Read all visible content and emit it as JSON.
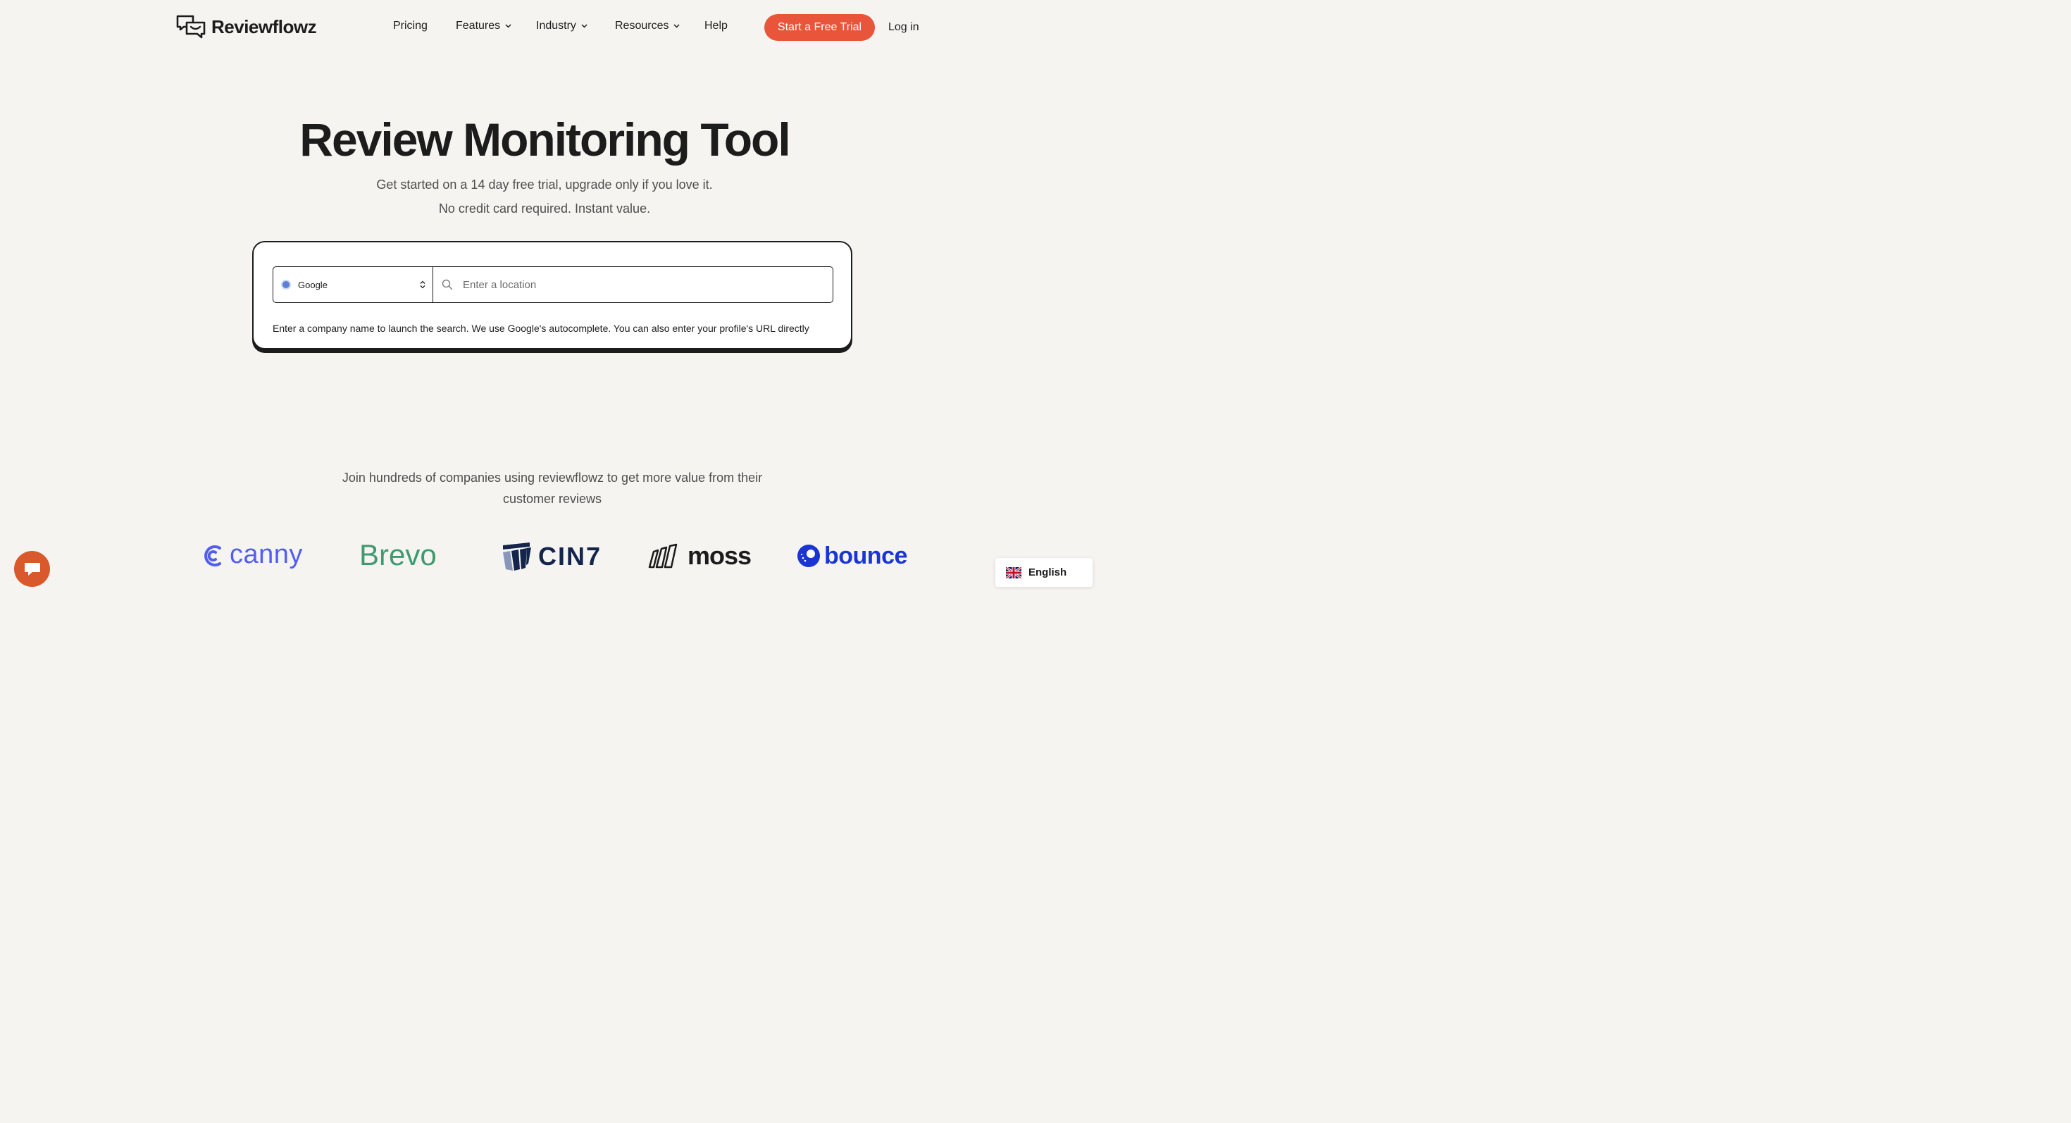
{
  "brand": {
    "name": "Reviewflowz",
    "accent": "#e8553b"
  },
  "nav": {
    "items": [
      {
        "label": "Pricing",
        "dropdown": false
      },
      {
        "label": "Features",
        "dropdown": true
      },
      {
        "label": "Industry",
        "dropdown": true
      },
      {
        "label": "Resources",
        "dropdown": true
      },
      {
        "label": "Help",
        "dropdown": false
      }
    ],
    "cta_label": "Start a Free Trial",
    "login_label": "Log in"
  },
  "hero": {
    "title": "Review Monitoring Tool",
    "subtitle_1": "Get started on a 14 day free trial, upgrade only if you love it.",
    "subtitle_2": "No credit card required. Instant value."
  },
  "search": {
    "platform_selected": "Google",
    "location_value": "",
    "location_placeholder": "Enter a location",
    "helper": "Enter a company name to launch the search. We use Google's autocomplete. You can also enter your profile's URL directly"
  },
  "social_proof": {
    "text": "Join hundreds of companies using reviewflowz to get more value from their customer reviews",
    "logos": [
      {
        "name": "canny",
        "color": "#525df4"
      },
      {
        "name": "Brevo",
        "color": "#3e9a6f"
      },
      {
        "name": "CIN7",
        "color": "#14254c"
      },
      {
        "name": "moss",
        "color": "#1c1c1c"
      },
      {
        "name": "bounce",
        "color": "#1a35d4"
      }
    ]
  },
  "language": {
    "label": "English",
    "flag": "uk-flag-icon"
  },
  "chat": {
    "icon": "chat-bubble-icon",
    "color": "#d9582c"
  }
}
